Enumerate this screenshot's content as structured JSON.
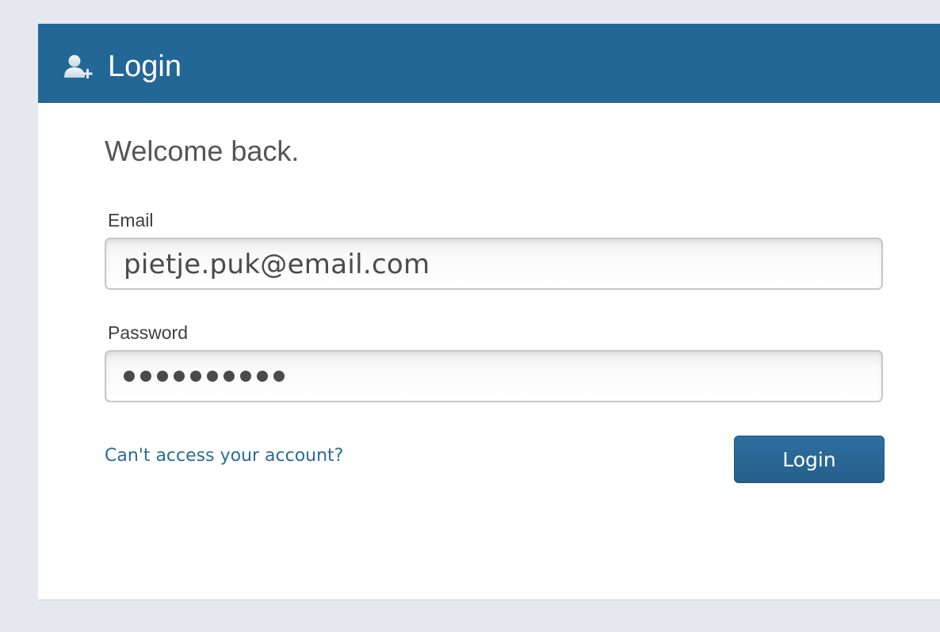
{
  "header": {
    "icon": "add-user-icon",
    "title": "Login"
  },
  "main": {
    "welcome_text": "Welcome back.",
    "email": {
      "label": "Email",
      "value": "pietje.puk@email.com"
    },
    "password": {
      "label": "Password",
      "masked_length": 10
    },
    "forgot_link": "Can't access your account?",
    "login_button": "Login"
  },
  "colors": {
    "header_bg": "#236797",
    "button_bg": "#2a6a98",
    "link": "#2a6a98",
    "page_bg": "#e5e8ec"
  }
}
